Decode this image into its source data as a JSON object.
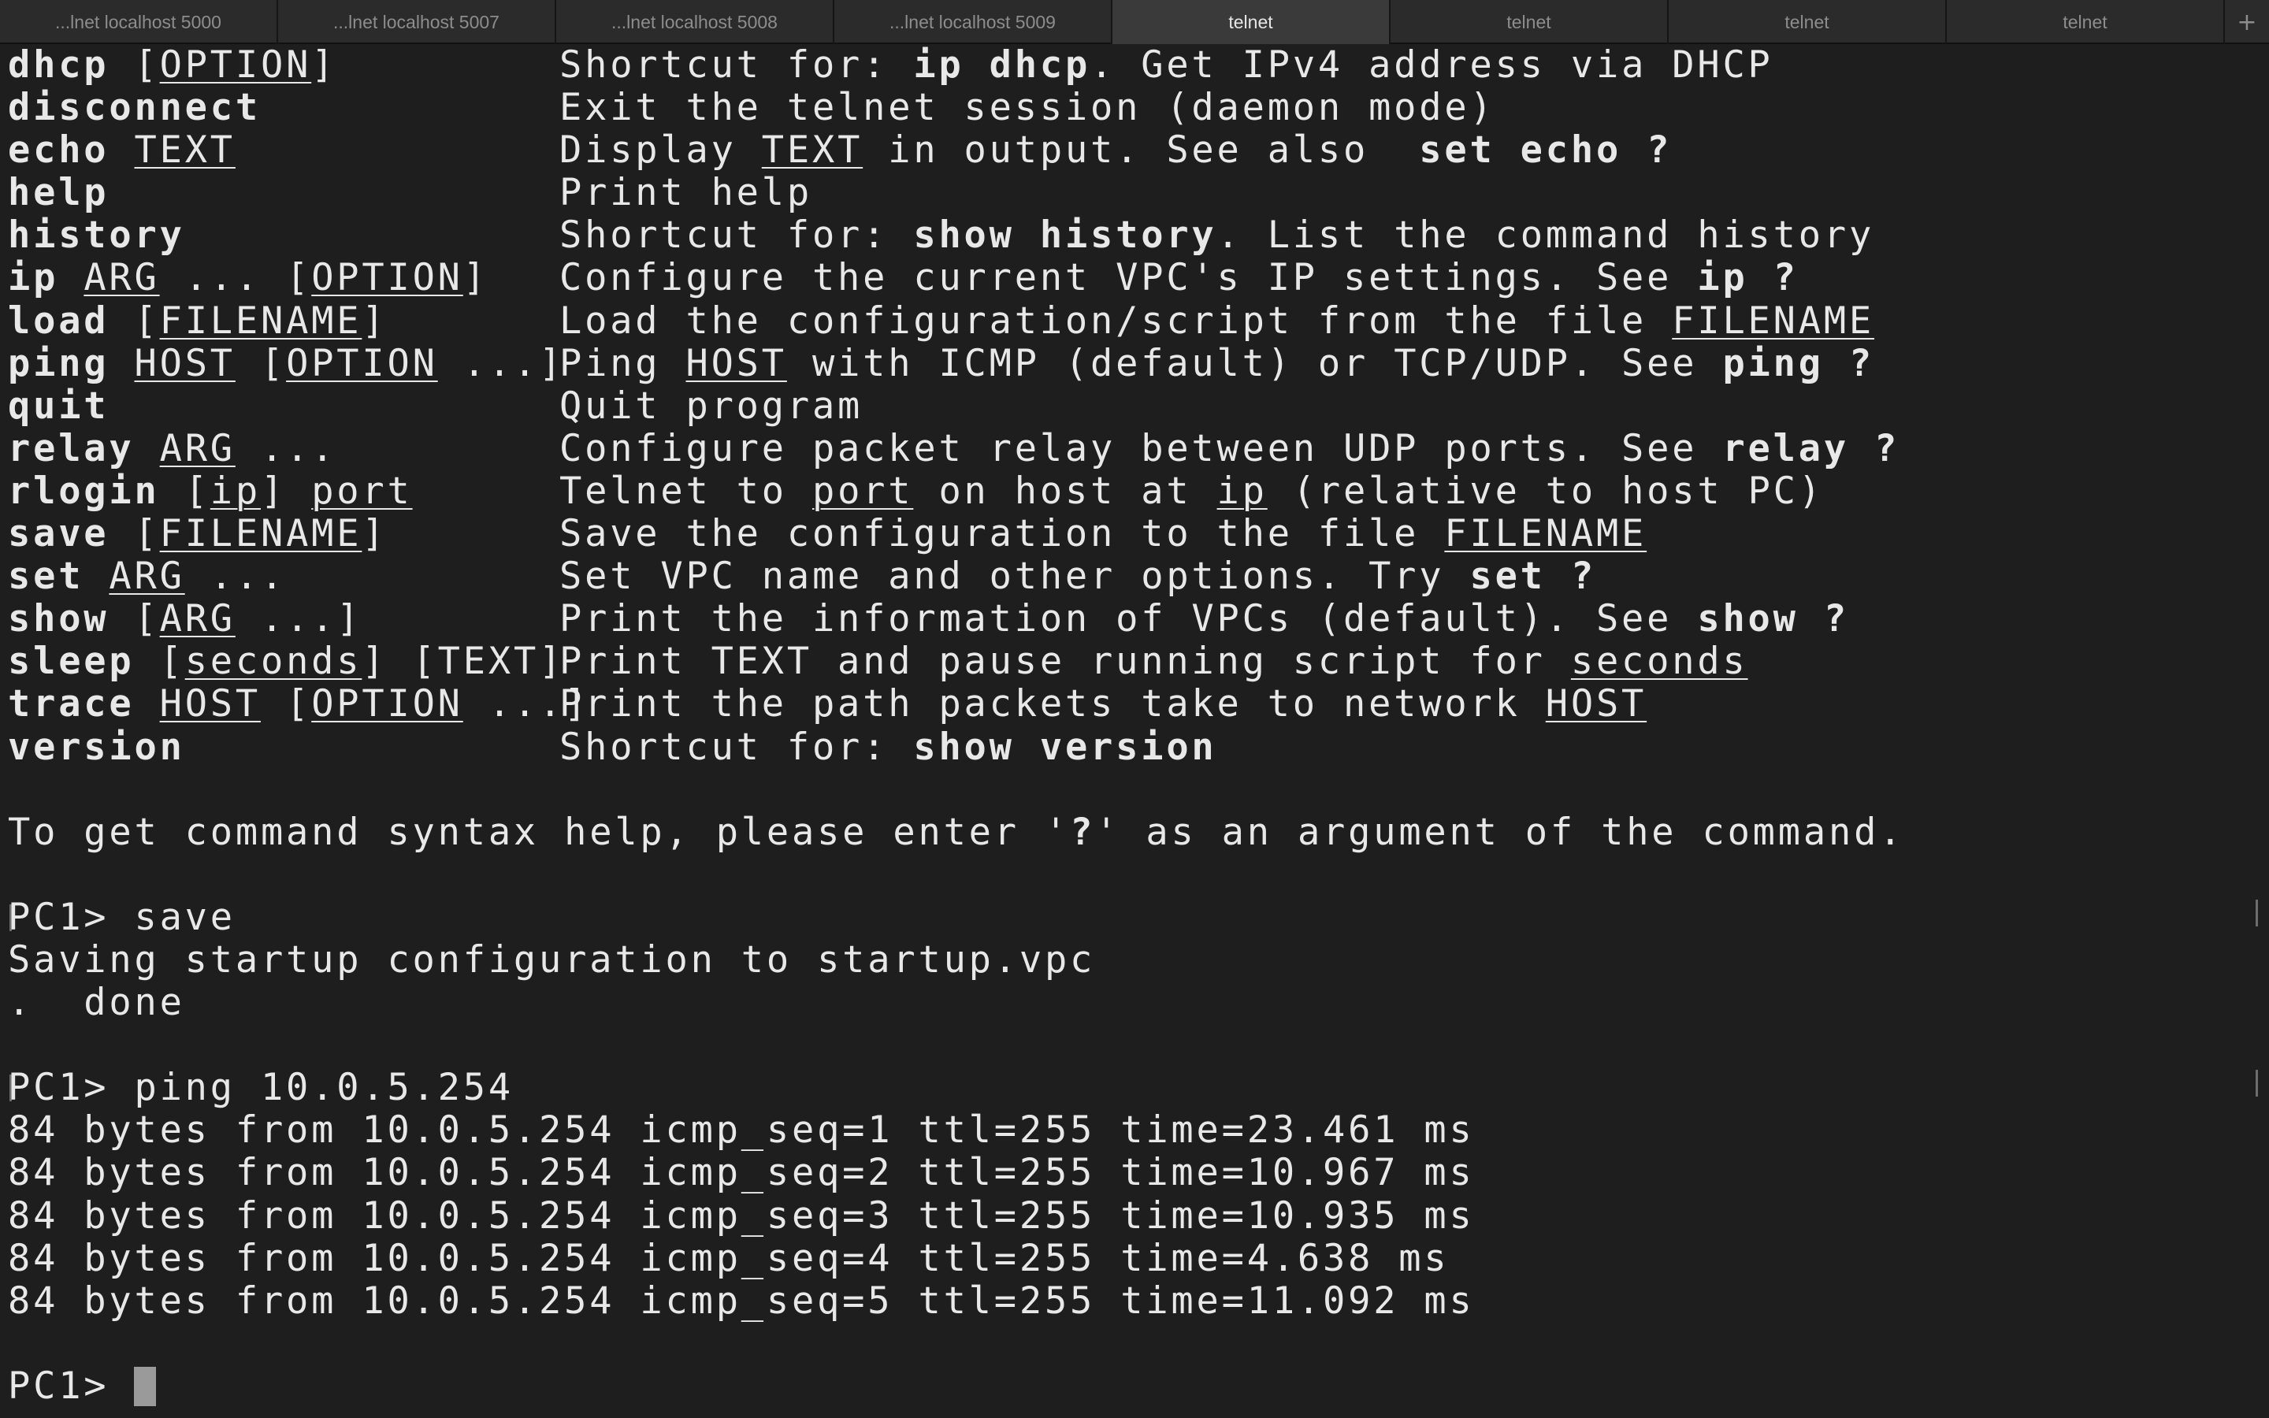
{
  "tabs": [
    {
      "label": "...lnet localhost 5000",
      "active": false
    },
    {
      "label": "...lnet localhost 5007",
      "active": false
    },
    {
      "label": "...lnet localhost 5008",
      "active": false
    },
    {
      "label": "...lnet localhost 5009",
      "active": false
    },
    {
      "label": "telnet",
      "active": true
    },
    {
      "label": "telnet",
      "active": false
    },
    {
      "label": "telnet",
      "active": false
    },
    {
      "label": "telnet",
      "active": false
    }
  ],
  "new_tab_label": "+",
  "help": [
    {
      "cmd": [
        [
          "b",
          "dhcp"
        ],
        [
          "t",
          " ["
        ],
        [
          "u",
          "OPTION"
        ],
        [
          "t",
          "]"
        ]
      ],
      "desc": [
        [
          "t",
          "Shortcut for: "
        ],
        [
          "b",
          "ip dhcp"
        ],
        [
          "t",
          ". Get IPv4 address via DHCP"
        ]
      ]
    },
    {
      "cmd": [
        [
          "b",
          "disconnect"
        ]
      ],
      "desc": [
        [
          "t",
          "Exit the telnet session (daemon mode)"
        ]
      ]
    },
    {
      "cmd": [
        [
          "b",
          "echo"
        ],
        [
          "t",
          " "
        ],
        [
          "u",
          "TEXT"
        ]
      ],
      "desc": [
        [
          "t",
          "Display "
        ],
        [
          "u",
          "TEXT"
        ],
        [
          "t",
          " in output. See also  "
        ],
        [
          "b",
          "set echo ?"
        ]
      ]
    },
    {
      "cmd": [
        [
          "b",
          "help"
        ]
      ],
      "desc": [
        [
          "t",
          "Print help"
        ]
      ]
    },
    {
      "cmd": [
        [
          "b",
          "history"
        ]
      ],
      "desc": [
        [
          "t",
          "Shortcut for: "
        ],
        [
          "b",
          "show history"
        ],
        [
          "t",
          ". List the command history"
        ]
      ]
    },
    {
      "cmd": [
        [
          "b",
          "ip"
        ],
        [
          "t",
          " "
        ],
        [
          "u",
          "ARG"
        ],
        [
          "t",
          " ... ["
        ],
        [
          "u",
          "OPTION"
        ],
        [
          "t",
          "]"
        ]
      ],
      "desc": [
        [
          "t",
          "Configure the current VPC's IP settings. See "
        ],
        [
          "b",
          "ip ?"
        ]
      ]
    },
    {
      "cmd": [
        [
          "b",
          "load"
        ],
        [
          "t",
          " ["
        ],
        [
          "u",
          "FILENAME"
        ],
        [
          "t",
          "]"
        ]
      ],
      "desc": [
        [
          "t",
          "Load the configuration/script from the file "
        ],
        [
          "u",
          "FILENAME"
        ]
      ]
    },
    {
      "cmd": [
        [
          "b",
          "ping"
        ],
        [
          "t",
          " "
        ],
        [
          "u",
          "HOST"
        ],
        [
          "t",
          " ["
        ],
        [
          "u",
          "OPTION"
        ],
        [
          "t",
          " ...]"
        ]
      ],
      "desc": [
        [
          "t",
          "Ping "
        ],
        [
          "u",
          "HOST"
        ],
        [
          "t",
          " with ICMP (default) or TCP/UDP. See "
        ],
        [
          "b",
          "ping ?"
        ]
      ]
    },
    {
      "cmd": [
        [
          "b",
          "quit"
        ]
      ],
      "desc": [
        [
          "t",
          "Quit program"
        ]
      ]
    },
    {
      "cmd": [
        [
          "b",
          "relay"
        ],
        [
          "t",
          " "
        ],
        [
          "u",
          "ARG"
        ],
        [
          "t",
          " ..."
        ]
      ],
      "desc": [
        [
          "t",
          "Configure packet relay between UDP ports. See "
        ],
        [
          "b",
          "relay ?"
        ]
      ]
    },
    {
      "cmd": [
        [
          "b",
          "rlogin"
        ],
        [
          "t",
          " ["
        ],
        [
          "u",
          "ip"
        ],
        [
          "t",
          "] "
        ],
        [
          "u",
          "port"
        ]
      ],
      "desc": [
        [
          "t",
          "Telnet to "
        ],
        [
          "u",
          "port"
        ],
        [
          "t",
          " on host at "
        ],
        [
          "u",
          "ip"
        ],
        [
          "t",
          " (relative to host PC)"
        ]
      ]
    },
    {
      "cmd": [
        [
          "b",
          "save"
        ],
        [
          "t",
          " ["
        ],
        [
          "u",
          "FILENAME"
        ],
        [
          "t",
          "]"
        ]
      ],
      "desc": [
        [
          "t",
          "Save the configuration to the file "
        ],
        [
          "u",
          "FILENAME"
        ]
      ]
    },
    {
      "cmd": [
        [
          "b",
          "set"
        ],
        [
          "t",
          " "
        ],
        [
          "u",
          "ARG"
        ],
        [
          "t",
          " ..."
        ]
      ],
      "desc": [
        [
          "t",
          "Set VPC name and other options. Try "
        ],
        [
          "b",
          "set ?"
        ]
      ]
    },
    {
      "cmd": [
        [
          "b",
          "show"
        ],
        [
          "t",
          " ["
        ],
        [
          "u",
          "ARG"
        ],
        [
          "t",
          " ...]"
        ]
      ],
      "desc": [
        [
          "t",
          "Print the information of VPCs (default). See "
        ],
        [
          "b",
          "show ?"
        ]
      ]
    },
    {
      "cmd": [
        [
          "b",
          "sleep"
        ],
        [
          "t",
          " ["
        ],
        [
          "u",
          "seconds"
        ],
        [
          "t",
          "] [TEXT]"
        ]
      ],
      "desc": [
        [
          "t",
          "Print TEXT and pause running script for "
        ],
        [
          "u",
          "seconds"
        ]
      ]
    },
    {
      "cmd": [
        [
          "b",
          "trace"
        ],
        [
          "t",
          " "
        ],
        [
          "u",
          "HOST"
        ],
        [
          "t",
          " ["
        ],
        [
          "u",
          "OPTION"
        ],
        [
          "t",
          " ...]"
        ]
      ],
      "desc": [
        [
          "t",
          "Print the path packets take to network "
        ],
        [
          "u",
          "HOST"
        ]
      ]
    },
    {
      "cmd": [
        [
          "b",
          "version"
        ]
      ],
      "desc": [
        [
          "t",
          "Shortcut for: "
        ],
        [
          "b",
          "show version"
        ]
      ]
    }
  ],
  "syntax_hint": [
    [
      "t",
      "To get command syntax help, please enter '"
    ],
    [
      "b",
      "?"
    ],
    [
      "t",
      "' as an argument of the command."
    ]
  ],
  "session": {
    "prompt1": "PC1> save",
    "save_out1": "Saving startup configuration to startup.vpc",
    "save_out2": ".  done",
    "prompt2": "PC1> ping 10.0.5.254",
    "ping_lines": [
      "84 bytes from 10.0.5.254 icmp_seq=1 ttl=255 time=23.461 ms",
      "84 bytes from 10.0.5.254 icmp_seq=2 ttl=255 time=10.967 ms",
      "84 bytes from 10.0.5.254 icmp_seq=3 ttl=255 time=10.935 ms",
      "84 bytes from 10.0.5.254 icmp_seq=4 ttl=255 time=4.638 ms",
      "84 bytes from 10.0.5.254 icmp_seq=5 ttl=255 time=11.092 ms"
    ],
    "prompt3": "PC1> "
  },
  "colors": {
    "background": "#1e1e1e",
    "text": "#e8e8e8",
    "tabbar": "#2b2b2b",
    "active_tab": "#3a3a3a",
    "cursor": "#9a9a9a"
  }
}
